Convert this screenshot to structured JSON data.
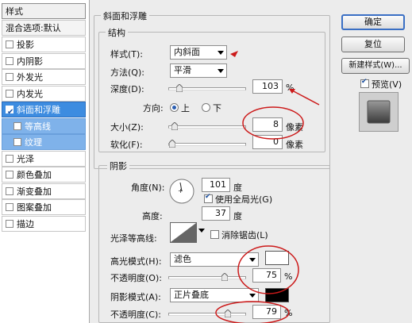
{
  "window": {
    "section_title": "斜面和浮雕",
    "structure_title": "结构",
    "shadow_title": "阴影"
  },
  "sidebar": {
    "title": "样式",
    "blend_options": "混合选项:默认",
    "items": [
      {
        "label": "投影",
        "checked": false
      },
      {
        "label": "内阴影",
        "checked": false
      },
      {
        "label": "外发光",
        "checked": false
      },
      {
        "label": "内发光",
        "checked": false
      },
      {
        "label": "斜面和浮雕",
        "checked": true,
        "selected": true
      },
      {
        "label": "等高线",
        "checked": false,
        "sub": true
      },
      {
        "label": "纹理",
        "checked": false,
        "sub": true
      },
      {
        "label": "光泽",
        "checked": false
      },
      {
        "label": "颜色叠加",
        "checked": false
      },
      {
        "label": "渐变叠加",
        "checked": false
      },
      {
        "label": "图案叠加",
        "checked": false
      },
      {
        "label": "描边",
        "checked": false
      }
    ]
  },
  "structure": {
    "style_label": "样式(T):",
    "style_value": "内斜面",
    "method_label": "方法(Q):",
    "method_value": "平滑",
    "depth_label": "深度(D):",
    "depth_value": "103",
    "depth_unit": "%",
    "depth_level": 0.1,
    "direction_label": "方向:",
    "direction_up": "上",
    "direction_down": "下",
    "size_label": "大小(Z):",
    "size_value": "8",
    "size_unit": "像素",
    "size_level": 0.03,
    "soften_label": "软化(F):",
    "soften_value": "0",
    "soften_unit": "像素",
    "soften_level": 0.0
  },
  "shading": {
    "angle_label": "角度(N):",
    "angle_value": "101",
    "angle_unit": "度",
    "global_light_label": "使用全局光(G)",
    "global_light_checked": true,
    "altitude_label": "高度:",
    "altitude_value": "37",
    "altitude_unit": "度",
    "gloss_contour_label": "光泽等高线:",
    "antialias_label": "消除锯齿(L)",
    "antialias_checked": false,
    "highlight_mode_label": "高光模式(H):",
    "highlight_mode_value": "滤色",
    "highlight_color": "#ffffff",
    "highlight_opacity_label": "不透明度(O):",
    "highlight_opacity_value": "75",
    "highlight_opacity_unit": "%",
    "highlight_opacity_level": 0.75,
    "shadow_mode_label": "阴影模式(A):",
    "shadow_mode_value": "正片叠底",
    "shadow_color": "#000000",
    "shadow_opacity_label": "不透明度(C):",
    "shadow_opacity_value": "79",
    "shadow_opacity_unit": "%",
    "shadow_opacity_level": 0.79
  },
  "buttons": {
    "ok": "确定",
    "reset": "复位",
    "new_style": "新建样式(W)...",
    "preview_label": "预览(V)",
    "preview_checked": true
  },
  "colors": {
    "selection_blue": "#3d8ce0",
    "annotation_red": "#cc1a1a"
  },
  "icons": {
    "preview_swatch": "bevel-preview-icon",
    "contour": "gloss-contour-icon",
    "angle_dial": "angle-dial-icon"
  }
}
